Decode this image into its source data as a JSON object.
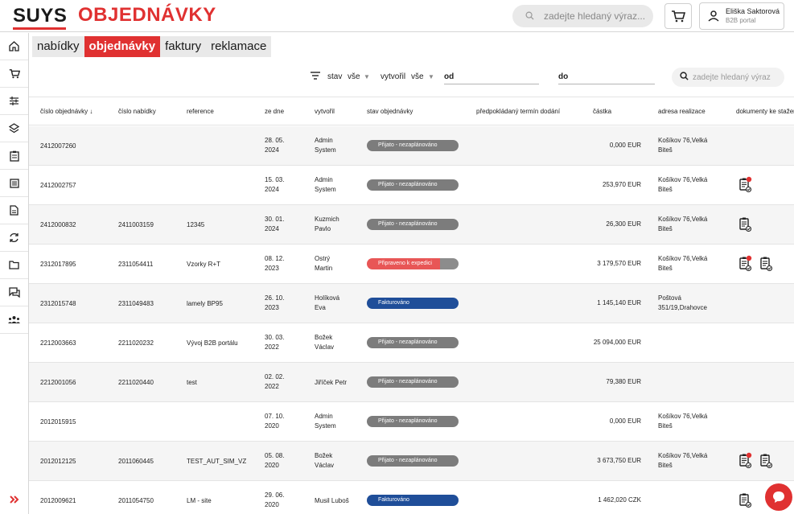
{
  "header": {
    "logo": "SUYS",
    "title": "OBJEDNÁVKY",
    "search_placeholder": "zadejte hledaný výraz...",
    "user_name": "Eliška Saktorová",
    "user_role": "B2B portal"
  },
  "tabs": [
    {
      "label": "nabídky"
    },
    {
      "label": "objednávky",
      "active": true
    },
    {
      "label": "faktury"
    },
    {
      "label": "reklamace"
    }
  ],
  "filters": {
    "stav_label": "stav",
    "stav_value": "vše",
    "vytvoril_label": "vytvořil",
    "vytvoril_value": "vše",
    "od_label": "od",
    "do_label": "do",
    "search_placeholder": "zadejte hledaný výraz"
  },
  "columns": {
    "cislo_objednavky": "číslo objednávky",
    "cislo_nabidky": "číslo nabídky",
    "reference": "reference",
    "ze_dne": "ze dne",
    "vytvoril": "vytvořil",
    "stav": "stav objednávky",
    "termin": "předpokládaný termín dodání",
    "castka": "částka",
    "adresa": "adresa realizace",
    "dokumenty": "dokumenty ke stažení"
  },
  "rows": [
    {
      "order": "2412007260",
      "offer": "",
      "ref": "",
      "date1": "28. 05.",
      "date2": "2024",
      "by1": "Admin",
      "by2": "System",
      "status": "Přijato - nezaplánováno",
      "status_type": "grey",
      "amount": "0,000 EUR",
      "addr1": "Košíkov 76,Velká",
      "addr2": "Biteš",
      "docs": []
    },
    {
      "order": "2412002757",
      "offer": "",
      "ref": "",
      "date1": "15. 03.",
      "date2": "2024",
      "by1": "Admin",
      "by2": "System",
      "status": "Přijato - nezaplánováno",
      "status_type": "grey",
      "amount": "253,970 EUR",
      "addr1": "Košíkov 76,Velká",
      "addr2": "Biteš",
      "docs": [
        "badge"
      ]
    },
    {
      "order": "2412000832",
      "offer": "2411003159",
      "ref": "12345",
      "date1": "30. 01.",
      "date2": "2024",
      "by1": "Kuzmich",
      "by2": "Pavlo",
      "status": "Přijato - nezaplánováno",
      "status_type": "grey",
      "amount": "26,300 EUR",
      "addr1": "Košíkov 76,Velká",
      "addr2": "Biteš",
      "docs": [
        "plain"
      ]
    },
    {
      "order": "2312017895",
      "offer": "2311054411",
      "ref": "Vzorky R+T",
      "date1": "08. 12.",
      "date2": "2023",
      "by1": "Ostrý",
      "by2": "Martin",
      "status": "Připraveno k expedici",
      "status_type": "red",
      "amount": "3 179,570 EUR",
      "addr1": "Košíkov 76,Velká",
      "addr2": "Biteš",
      "docs": [
        "badge",
        "plain"
      ]
    },
    {
      "order": "2312015748",
      "offer": "2311049483",
      "ref": "lamely BP95",
      "date1": "26. 10.",
      "date2": "2023",
      "by1": "Holíková",
      "by2": "Eva",
      "status": "Fakturováno",
      "status_type": "blue",
      "amount": "1 145,140 EUR",
      "addr1": "Poštová",
      "addr2": "351/19,Drahovce",
      "docs": []
    },
    {
      "order": "2212003663",
      "offer": "2211020232",
      "ref": "Vývoj B2B portálu",
      "date1": "30. 03.",
      "date2": "2022",
      "by1": "Božek",
      "by2": "Václav",
      "status": "Přijato - nezaplánováno",
      "status_type": "grey",
      "amount": "25 094,000 EUR",
      "addr1": "",
      "addr2": "",
      "docs": []
    },
    {
      "order": "2212001056",
      "offer": "2211020440",
      "ref": "test",
      "date1": "02. 02.",
      "date2": "2022",
      "by1": "Jiříček Petr",
      "by2": "",
      "status": "Přijato - nezaplánováno",
      "status_type": "grey",
      "amount": "79,380 EUR",
      "addr1": "",
      "addr2": "",
      "docs": []
    },
    {
      "order": "2012015915",
      "offer": "",
      "ref": "",
      "date1": "07. 10.",
      "date2": "2020",
      "by1": "Admin",
      "by2": "System",
      "status": "Přijato - nezaplánováno",
      "status_type": "grey",
      "amount": "0,000 EUR",
      "addr1": "Košíkov 76,Velká",
      "addr2": "Biteš",
      "docs": []
    },
    {
      "order": "2012012125",
      "offer": "2011060445",
      "ref": "TEST_AUT_SIM_VZ",
      "date1": "05. 08.",
      "date2": "2020",
      "by1": "Božek",
      "by2": "Václav",
      "status": "Přijato - nezaplánováno",
      "status_type": "grey",
      "amount": "3 673,750 EUR",
      "addr1": "Košíkov 76,Velká",
      "addr2": "Biteš",
      "docs": [
        "badge",
        "plain"
      ]
    },
    {
      "order": "2012009621",
      "offer": "2011054750",
      "ref": "LM - site",
      "date1": "29. 06.",
      "date2": "2020",
      "by1": "Musil Luboš",
      "by2": "",
      "status": "Fakturováno",
      "status_type": "blue",
      "amount": "1 462,020 CZK",
      "addr1": "",
      "addr2": "",
      "docs": [
        "plain"
      ]
    }
  ],
  "colors": {
    "accent": "#e03131",
    "blue": "#1f4e99",
    "grey": "#7c7c7c"
  }
}
